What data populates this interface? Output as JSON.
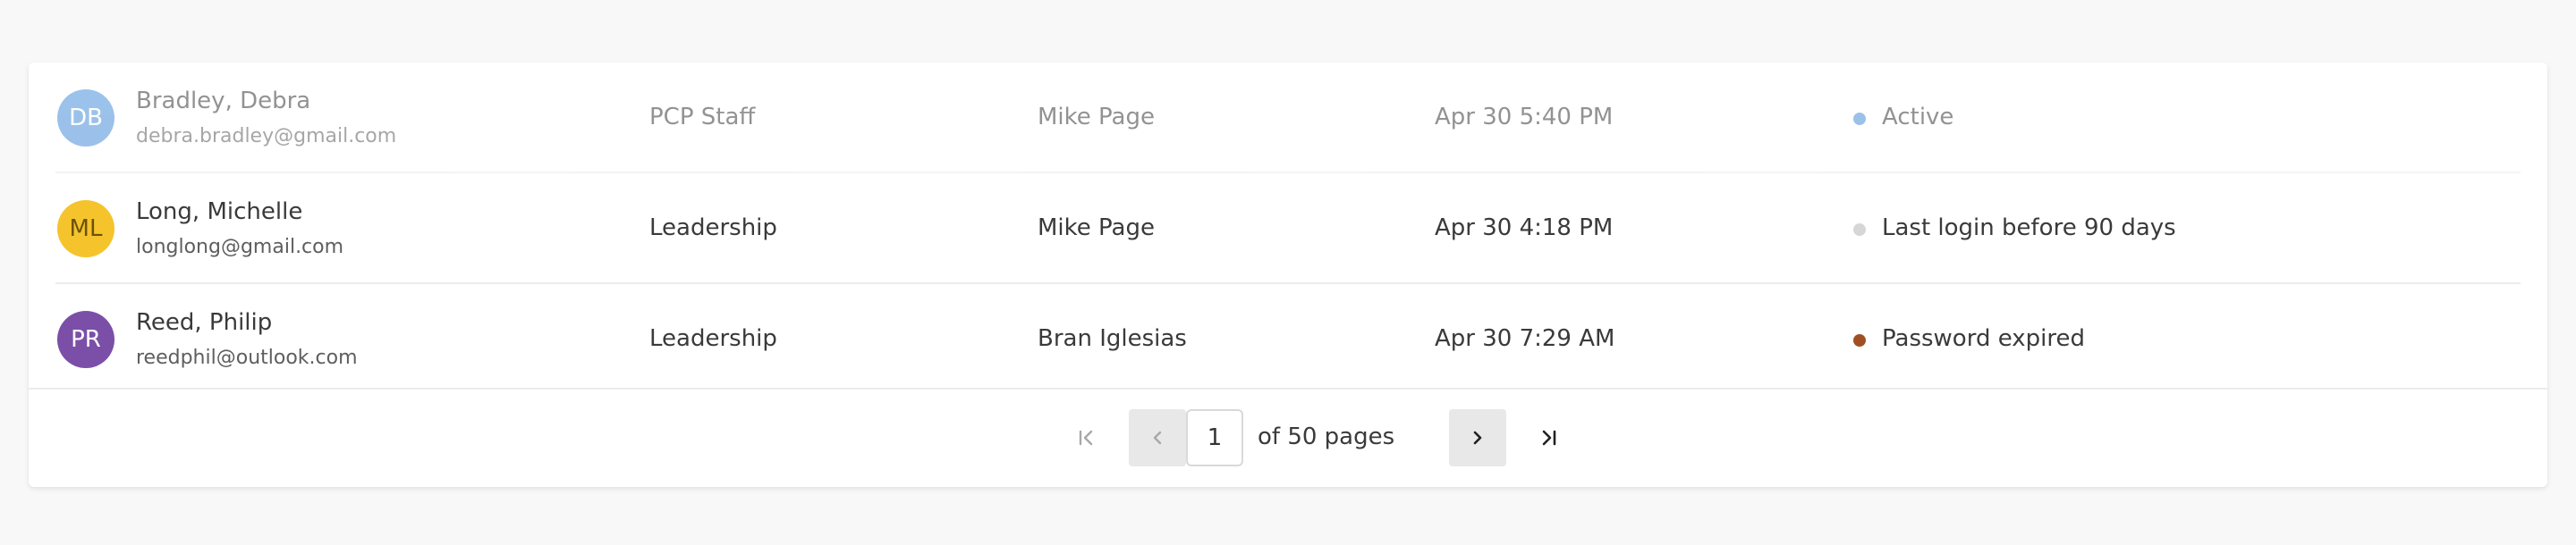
{
  "users": [
    {
      "initials": "DB",
      "name": "Bradley, Debra",
      "email": "debra.bradley@gmail.com",
      "role": "PCP Staff",
      "owner": "Mike Page",
      "last_activity": "Apr 30 5:40 PM",
      "status": "Active",
      "avatar_color": "#4a90d9",
      "status_color": "#4a90d9"
    },
    {
      "initials": "ML",
      "name": "Long, Michelle",
      "email": "longlong@gmail.com",
      "role": "Leadership",
      "owner": "Mike Page",
      "last_activity": "Apr 30 4:18 PM",
      "status": "Last login before 90 days",
      "avatar_color": "#f5c42c",
      "status_color": "#d6d6d6"
    },
    {
      "initials": "PR",
      "name": "Reed, Philip",
      "email": "reedphil@outlook.com",
      "role": "Leadership",
      "owner": "Bran Iglesias",
      "last_activity": "Apr 30 7:29 AM",
      "status": "Password expired",
      "avatar_color": "#7b4fa8",
      "status_color": "#a14f22"
    }
  ],
  "pagination": {
    "current_page": "1",
    "of_pages_label": "of 50 pages",
    "first_icon": "first-page-icon",
    "prev_icon": "chevron-left-icon",
    "next_icon": "chevron-right-icon",
    "last_icon": "last-page-icon"
  }
}
